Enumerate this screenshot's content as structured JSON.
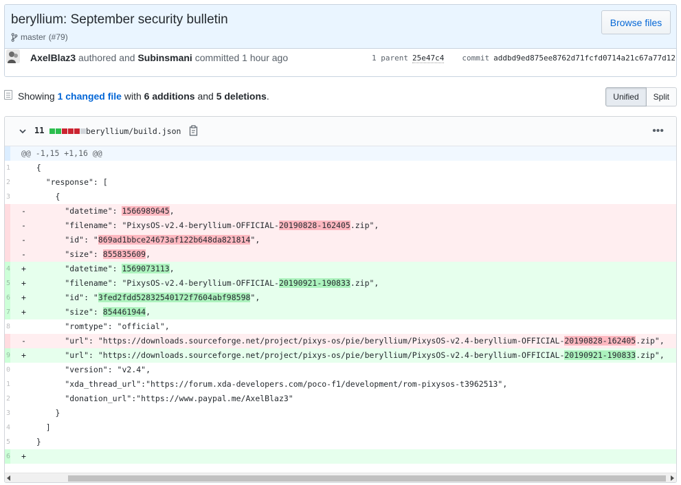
{
  "commit": {
    "title": "beryllium: September security bulletin",
    "branch": "master",
    "pr": "(#79)",
    "browse_label": "Browse files",
    "author": "AxelBlaz3",
    "authored_word": "authored and",
    "committer": "Subinsmani",
    "committed_word": "committed 1 hour ago",
    "parent_label": "1 parent",
    "parent_sha": "25e47c4",
    "commit_label": "commit",
    "commit_sha": "addbd9ed875ee8762d71fcfd0714a21c67a77d12"
  },
  "toc": {
    "showing": "Showing",
    "changed": "1 changed file",
    "with": "with",
    "additions": "6 additions",
    "and": "and",
    "deletions": "5 deletions",
    "period": ".",
    "unified_label": "Unified",
    "split_label": "Split"
  },
  "file": {
    "stat": "11",
    "name": "beryllium/build.json",
    "more_icon": "kebab-icon",
    "blocks": [
      "#2cbe4e",
      "#2cbe4e",
      "#cb2431",
      "#cb2431",
      "#cb2431"
    ]
  },
  "diff": {
    "hunk": "@@ -1,15 +1,16 @@",
    "rows": [
      {
        "type": "ctx",
        "num": "1",
        "mark": "",
        "pre": "  {",
        "hl": "",
        "post": ""
      },
      {
        "type": "ctx",
        "num": "2",
        "mark": "",
        "pre": "    \"response\": [",
        "hl": "",
        "post": ""
      },
      {
        "type": "ctx",
        "num": "3",
        "mark": "",
        "pre": "      {",
        "hl": "",
        "post": ""
      },
      {
        "type": "del",
        "num": "",
        "mark": "-",
        "pre": "        \"datetime\": ",
        "hl": "1566989645",
        "post": ","
      },
      {
        "type": "del",
        "num": "",
        "mark": "-",
        "pre": "        \"filename\": \"PixysOS-v2.4-beryllium-OFFICIAL-",
        "hl": "20190828-162405",
        "post": ".zip\","
      },
      {
        "type": "del",
        "num": "",
        "mark": "-",
        "pre": "        \"id\": \"",
        "hl": "869ad1bbce24673af122b648da821814",
        "post": "\","
      },
      {
        "type": "del",
        "num": "",
        "mark": "-",
        "pre": "        \"size\": ",
        "hl": "855835609",
        "post": ","
      },
      {
        "type": "add",
        "num": "4",
        "mark": "+",
        "pre": "        \"datetime\": ",
        "hl": "1569073113",
        "post": ","
      },
      {
        "type": "add",
        "num": "5",
        "mark": "+",
        "pre": "        \"filename\": \"PixysOS-v2.4-beryllium-OFFICIAL-",
        "hl": "20190921-190833",
        "post": ".zip\","
      },
      {
        "type": "add",
        "num": "6",
        "mark": "+",
        "pre": "        \"id\": \"",
        "hl": "3fed2fdd52832540172f7604abf98598",
        "post": "\","
      },
      {
        "type": "add",
        "num": "7",
        "mark": "+",
        "pre": "        \"size\": ",
        "hl": "854461944",
        "post": ","
      },
      {
        "type": "ctx",
        "num": "8",
        "mark": "",
        "pre": "        \"romtype\": \"official\",",
        "hl": "",
        "post": ""
      },
      {
        "type": "del",
        "num": "",
        "mark": "-",
        "pre": "        \"url\": \"https://downloads.sourceforge.net/project/pixys-os/pie/beryllium/PixysOS-v2.4-beryllium-OFFICIAL-",
        "hl": "20190828-162405",
        "post": ".zip\","
      },
      {
        "type": "add",
        "num": "9",
        "mark": "+",
        "pre": "        \"url\": \"https://downloads.sourceforge.net/project/pixys-os/pie/beryllium/PixysOS-v2.4-beryllium-OFFICIAL-",
        "hl": "20190921-190833",
        "post": ".zip\","
      },
      {
        "type": "ctx",
        "num": "0",
        "mark": "",
        "pre": "        \"version\": \"v2.4\",",
        "hl": "",
        "post": ""
      },
      {
        "type": "ctx",
        "num": "1",
        "mark": "",
        "pre": "        \"xda_thread_url\":\"https://forum.xda-developers.com/poco-f1/development/rom-pixysos-t3962513\",",
        "hl": "",
        "post": ""
      },
      {
        "type": "ctx",
        "num": "2",
        "mark": "",
        "pre": "        \"donation_url\":\"https://www.paypal.me/AxelBlaz3\"",
        "hl": "",
        "post": ""
      },
      {
        "type": "ctx",
        "num": "3",
        "mark": "",
        "pre": "      }",
        "hl": "",
        "post": ""
      },
      {
        "type": "ctx",
        "num": "4",
        "mark": "",
        "pre": "    ]",
        "hl": "",
        "post": ""
      },
      {
        "type": "ctx",
        "num": "5",
        "mark": "",
        "pre": "  }",
        "hl": "",
        "post": ""
      },
      {
        "type": "add",
        "num": "6",
        "mark": "+",
        "pre": "",
        "hl": "",
        "post": ""
      }
    ]
  }
}
